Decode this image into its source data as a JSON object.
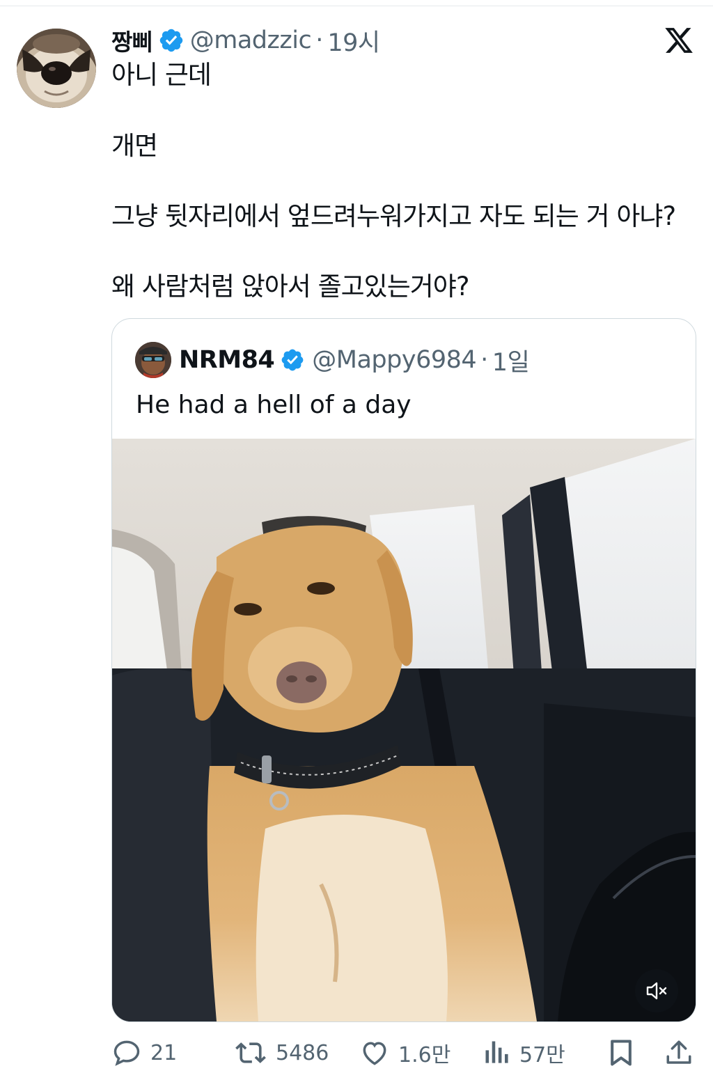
{
  "tweet": {
    "display_name": "짱삐",
    "handle": "@madzzic",
    "separator": "·",
    "time": "19시",
    "lines": [
      "아니 근데",
      "개면",
      "그냥 뒷자리에서 엎드려누워가지고 자도 되는 거 아냐?",
      "왜 사람처럼 앉아서 졸고있는거야?"
    ]
  },
  "quote": {
    "display_name": "NRM84",
    "handle": "@Mappy6984",
    "separator": "·",
    "time": "1일",
    "text": "He had a hell of a day"
  },
  "actions": {
    "replies": "21",
    "retweets": "5486",
    "likes": "1.6만",
    "views": "57만"
  },
  "colors": {
    "verified_blue": "#1d9bf0",
    "secondary_text": "#536471",
    "border": "#cfd9de"
  },
  "icons": [
    "x-logo-icon",
    "verified-badge-icon",
    "reply-icon",
    "retweet-icon",
    "like-icon",
    "views-icon",
    "bookmark-icon",
    "share-icon",
    "mute-icon"
  ]
}
